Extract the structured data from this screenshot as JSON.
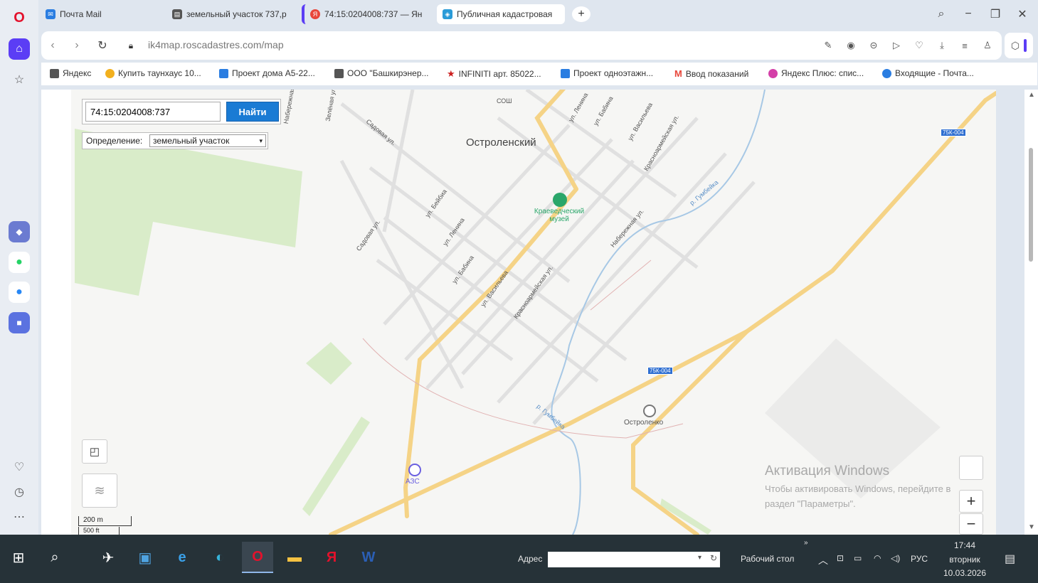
{
  "browser": {
    "tabs": [
      {
        "label": "Почта Mail",
        "icon": "mail-icon",
        "color": "#2a7de1"
      },
      {
        "label": "земельный участок 737,р",
        "icon": "document-icon",
        "color": "#555555"
      },
      {
        "label": "74:15:0204008:737 — Ян",
        "icon": "yandex-icon",
        "color": "#e8463a"
      },
      {
        "label": "Публичная кадастровая",
        "icon": "map-icon",
        "color": "#2a9bd8"
      }
    ],
    "new_tab": "+",
    "url_host": "pkk.rosreestr.ru/map",
    "url_prefix": "",
    "url_display": "ik4map.roscadastres.com/map",
    "bookmarks": [
      {
        "label": "Яндекс",
        "color": "#555555"
      },
      {
        "label": "Купить таунхаус 10...",
        "color": "#f2b01e"
      },
      {
        "label": "Проект дома А5-22...",
        "color": "#2a7de1"
      },
      {
        "label": "ООО \"Башкирэнер...",
        "color": "#555555"
      },
      {
        "label": "INFINITI арт. 85022...",
        "color": "#cc1f1f"
      },
      {
        "label": "Проект одноэтажн...",
        "color": "#2a7de1"
      },
      {
        "label": "Ввод показаний",
        "color": "#e8463a"
      },
      {
        "label": "Яндекс Плюс: спис...",
        "color": "#d43fa8"
      },
      {
        "label": "Входящие - Почта...",
        "color": "#2a7de1"
      }
    ]
  },
  "search": {
    "value": "74:15:0204008:737",
    "button_label": "Найти",
    "definition_label": "Определение:",
    "definition_value": "земельный участок"
  },
  "map": {
    "labels": {
      "settlement": "Остроленский",
      "museum": "Краеведческий музей",
      "gas_station": "АЗС",
      "station": "Остроленко",
      "school": "СОШ",
      "streets": [
        "Садовая ул.",
        "Садовая ул.",
        "ул. Бейбиа",
        "ул. Ленина",
        "ул. Бабина",
        "ул. Васильева",
        "Красноармейская ул.",
        "Набережная ул.",
        "р. Гумбейка",
        "р. Гумбейка",
        "ул. Ленина",
        "ул. Бабина",
        "ул. Васильева",
        "Красноармейская ул.",
        "Набережная ул.",
        "Зелёная ул."
      ]
    },
    "road_badges": [
      "75К-004",
      "75К-004"
    ],
    "scale": {
      "primary": "200 m",
      "secondary": "500 ft"
    },
    "zoom_in": "+",
    "zoom_out": "−"
  },
  "watermark": {
    "title": "Активация Windows",
    "line1": "Чтобы активировать Windows, перейдите в",
    "line2": "раздел \"Параметры\"."
  },
  "taskbar": {
    "address_label": "Адрес",
    "desktop_label": "Рабочий стол",
    "language": "РУС",
    "time": "17:44",
    "day": "вторник",
    "date": "10.03.2026"
  }
}
